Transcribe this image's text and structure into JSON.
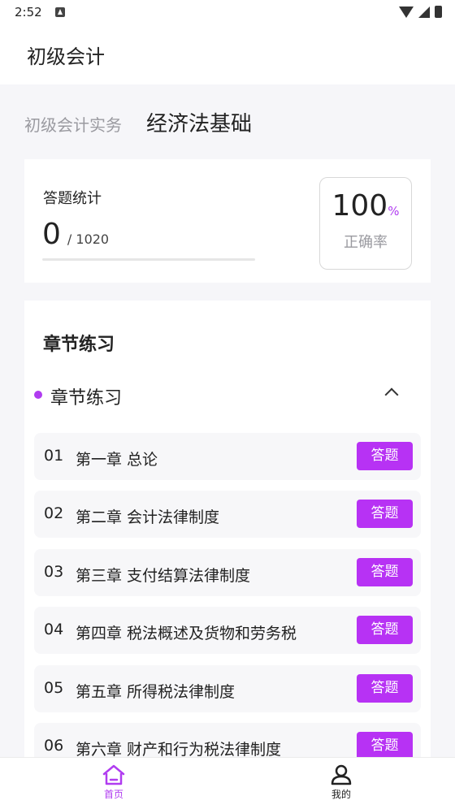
{
  "status_bar": {
    "time": "2:52"
  },
  "app_bar": {
    "title": "初级会计"
  },
  "tabs": [
    {
      "label": "初级会计实务",
      "active": false
    },
    {
      "label": "经济法基础",
      "active": true
    }
  ],
  "stats": {
    "label": "答题统计",
    "answered": "0",
    "total": "/ 1020",
    "progress": 0,
    "accuracy": "100",
    "accuracy_unit": "%",
    "accuracy_label": "正确率"
  },
  "section": {
    "title": "章节练习",
    "group_label": "章节练习"
  },
  "chapters": [
    {
      "num": "01",
      "title": "第一章 总论",
      "button": "答题"
    },
    {
      "num": "02",
      "title": "第二章 会计法律制度",
      "button": "答题"
    },
    {
      "num": "03",
      "title": "第三章 支付结算法律制度",
      "button": "答题"
    },
    {
      "num": "04",
      "title": "第四章 税法概述及货物和劳务税",
      "button": "答题"
    },
    {
      "num": "05",
      "title": "第五章 所得税法律制度",
      "button": "答题"
    },
    {
      "num": "06",
      "title": "第六章 财产和行为税法律制度",
      "button": "答题"
    }
  ],
  "bottom_nav": [
    {
      "label": "首页",
      "icon": "home-icon",
      "active": true
    },
    {
      "label": "我的",
      "icon": "profile-icon",
      "active": false
    }
  ],
  "colors": {
    "accent": "#b03cf0",
    "button": "#b732f4"
  }
}
